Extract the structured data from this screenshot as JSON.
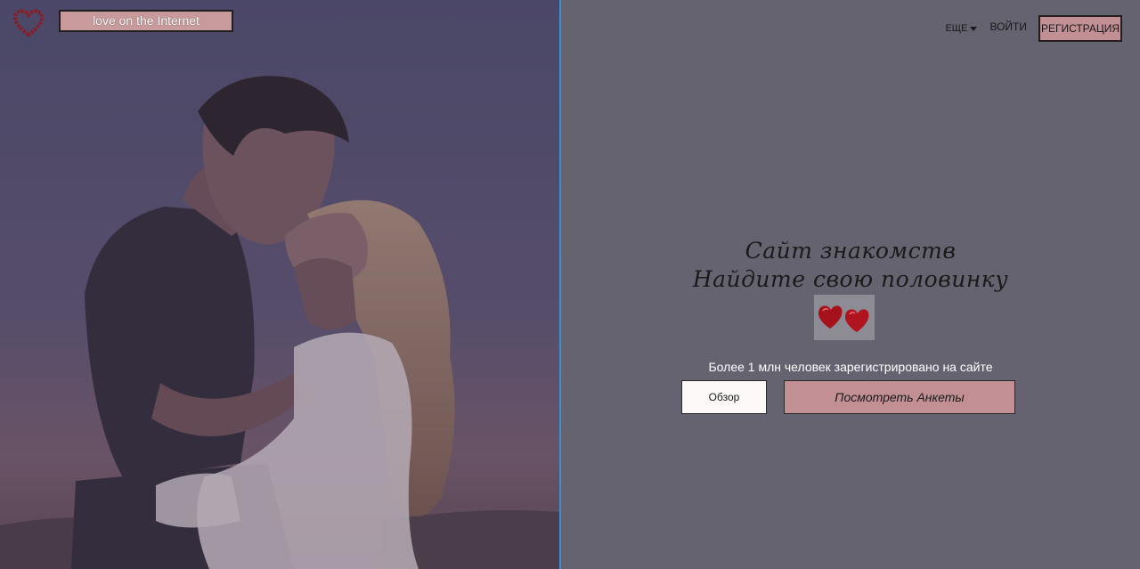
{
  "header": {
    "brand": "love on the Internet",
    "logo_icon": "heart-icon"
  },
  "nav": {
    "more_label": "ЕЩЕ",
    "login_label": "ВОЙТИ",
    "register_label": "РЕГИСТРАЦИЯ"
  },
  "hero": {
    "title_line1": "Сайт знакомств",
    "title_line2": "Найдите свою половинку",
    "hearts_image": "two-red-hearts-image"
  },
  "tagline": "Более 1 млн человек зарегистрировано на сайте",
  "buttons": {
    "browse_label": "Обзор",
    "profiles_label": "Посмотреть Анкеты"
  },
  "colors": {
    "accent_pink": "#c29094",
    "right_bg": "#64636f",
    "divider_blue": "#3a8fd6",
    "logo_red": "#8b1c24"
  }
}
